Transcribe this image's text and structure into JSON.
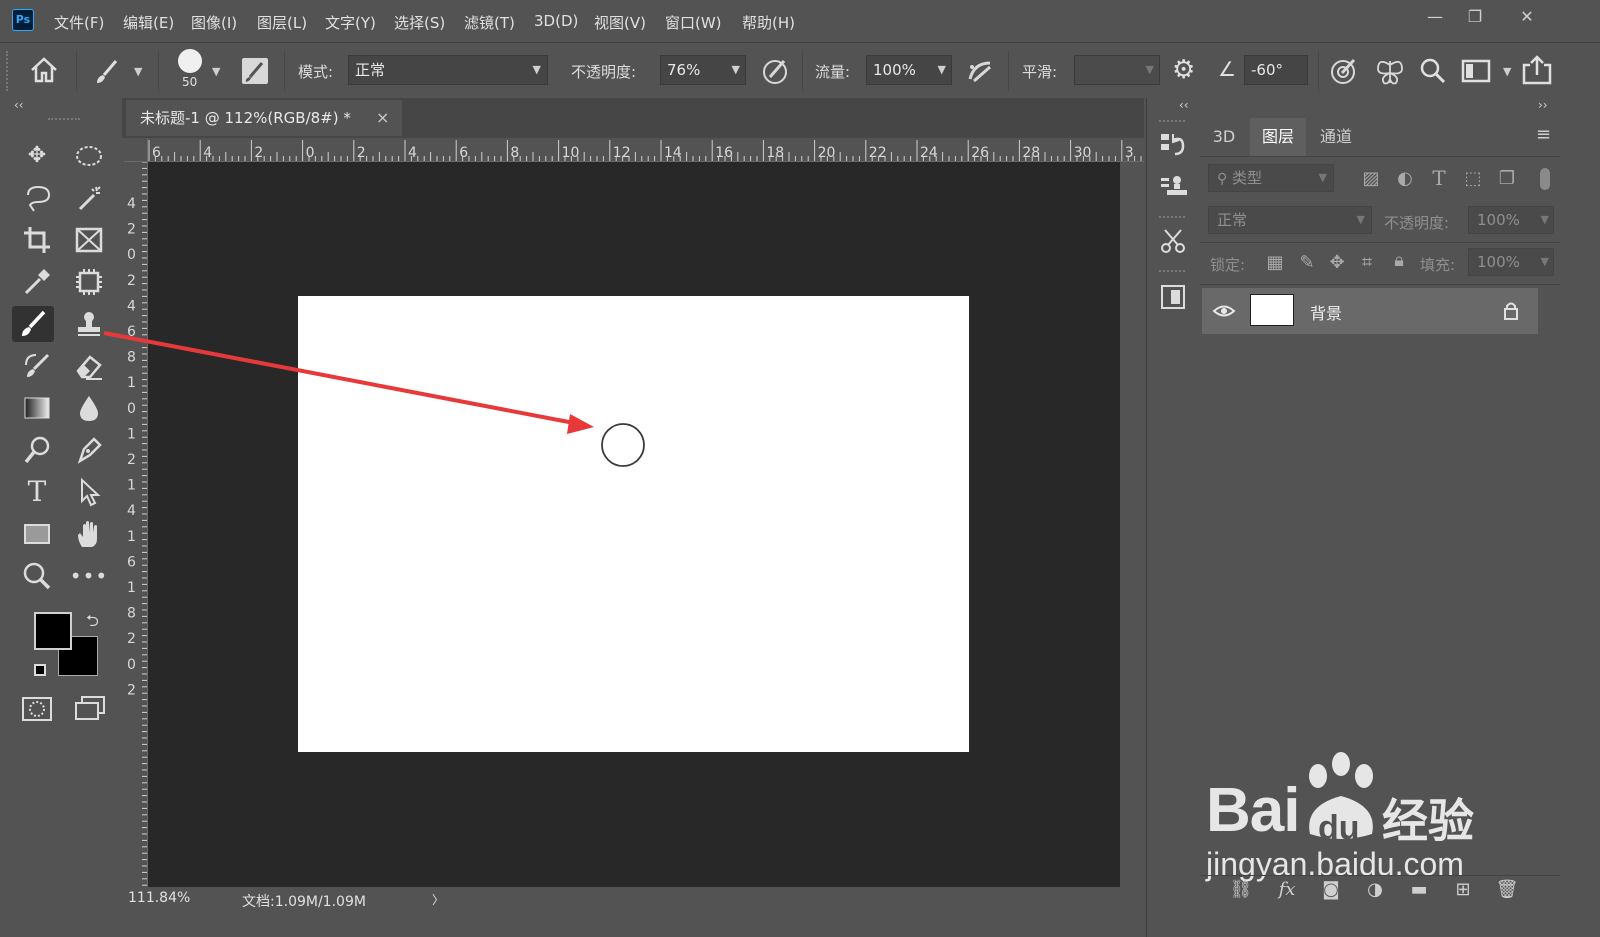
{
  "app": {
    "logo": "Ps"
  },
  "menu": [
    "文件(F)",
    "编辑(E)",
    "图像(I)",
    "图层(L)",
    "文字(Y)",
    "选择(S)",
    "滤镜(T)",
    "3D(D)",
    "视图(V)",
    "窗口(W)",
    "帮助(H)"
  ],
  "window_controls": {
    "minimize": "—",
    "restore": "❐",
    "close": "✕"
  },
  "options": {
    "brush_size": "50",
    "mode_label": "模式:",
    "mode_value": "正常",
    "opacity_label": "不透明度:",
    "opacity_value": "76%",
    "flow_label": "流量:",
    "flow_value": "100%",
    "smoothing_label": "平滑:",
    "smoothing_value": "",
    "angle_value": "-60°"
  },
  "document": {
    "tab_title": "未标题-1 @ 112%(RGB/8#) *",
    "tab_close": "×",
    "ruler_top": [
      "6",
      "4",
      "2",
      "0",
      "2",
      "4",
      "6",
      "8",
      "10",
      "12",
      "14",
      "16",
      "18",
      "20",
      "22",
      "24",
      "26",
      "28",
      "30",
      "3"
    ],
    "ruler_left": [
      "4",
      "2",
      "0",
      "2",
      "4",
      "6",
      "8",
      "1",
      "0",
      "1",
      "2",
      "1",
      "4",
      "1",
      "6",
      "1",
      "8",
      "2",
      "0",
      "2"
    ],
    "zoom": "111.84%",
    "doc_info": "文档:1.09M/1.09M",
    "status_arrow": "〉"
  },
  "panel_collapse": {
    "left": "‹‹",
    "mid": "‹‹",
    "right": "››"
  },
  "layers_panel": {
    "tabs": [
      "3D",
      "图层",
      "通道"
    ],
    "active_tab": "图层",
    "filter_placeholder": "类型",
    "blend_mode": "正常",
    "opacity_label": "不透明度:",
    "opacity_value": "100%",
    "lock_label": "锁定:",
    "fill_label": "填充:",
    "fill_value": "100%",
    "layers": [
      {
        "name": "背景",
        "visible": true,
        "locked": true
      }
    ]
  },
  "watermark": {
    "brand": "Bai",
    "du": "du",
    "suffix": "经验",
    "url": "jingyan.baidu.com"
  },
  "colors": {
    "ui_bg": "#535353",
    "pasteboard": "#282828",
    "annotation_arrow": "#e8393a",
    "foreground": "#000000",
    "background": "#000000"
  }
}
